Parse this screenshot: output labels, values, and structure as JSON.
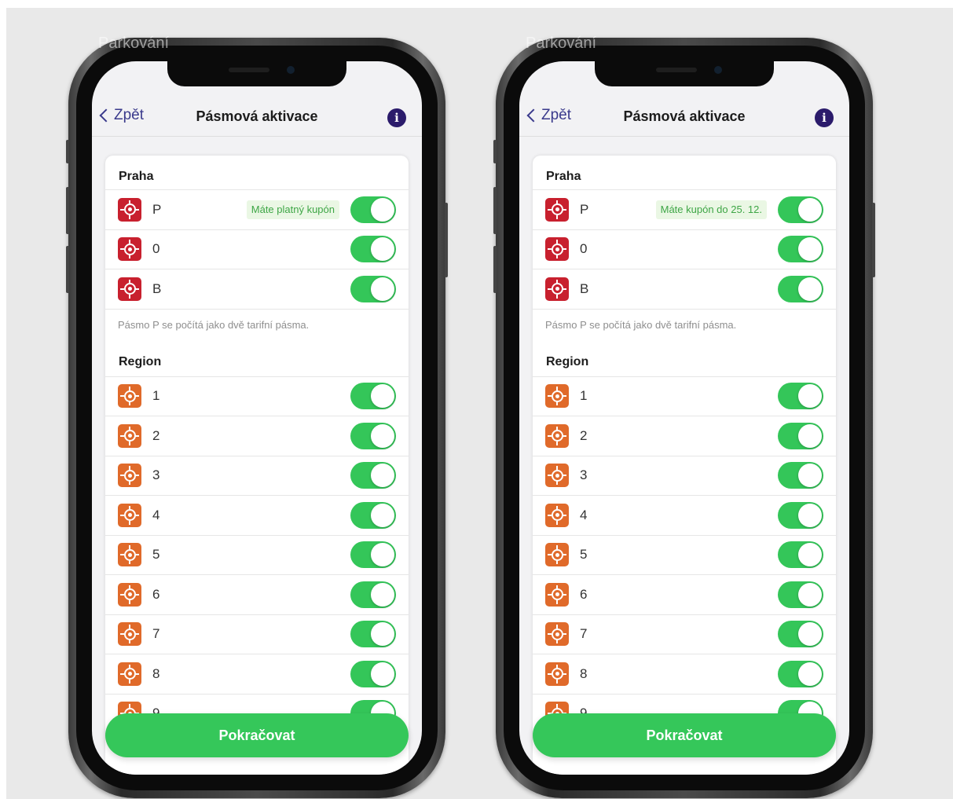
{
  "app_window_title": "Parkování",
  "screens": [
    {
      "nav": {
        "back_label": "Zpět",
        "title": "Pásmová aktivace",
        "info_glyph": "i"
      },
      "praha": {
        "title": "Praha",
        "zones": [
          {
            "label": "P",
            "icon": "target-icon",
            "color": "#c8202e",
            "on": true,
            "badge": "Máte platný kupón"
          },
          {
            "label": "0",
            "icon": "target-icon",
            "color": "#c8202e",
            "on": true
          },
          {
            "label": "B",
            "icon": "target-icon",
            "color": "#c8202e",
            "on": true
          }
        ],
        "note": "Pásmo P se počítá jako dvě tarifní pásma."
      },
      "region": {
        "title": "Region",
        "zones": [
          {
            "label": "1",
            "icon": "target-icon",
            "color": "#e06a2a",
            "on": true
          },
          {
            "label": "2",
            "icon": "target-icon",
            "color": "#e06a2a",
            "on": true
          },
          {
            "label": "3",
            "icon": "target-icon",
            "color": "#e06a2a",
            "on": true
          },
          {
            "label": "4",
            "icon": "target-icon",
            "color": "#e06a2a",
            "on": true
          },
          {
            "label": "5",
            "icon": "target-icon",
            "color": "#e06a2a",
            "on": true
          },
          {
            "label": "6",
            "icon": "target-icon",
            "color": "#e06a2a",
            "on": true
          },
          {
            "label": "7",
            "icon": "target-icon",
            "color": "#e06a2a",
            "on": true
          },
          {
            "label": "8",
            "icon": "target-icon",
            "color": "#e06a2a",
            "on": true
          },
          {
            "label": "9",
            "icon": "target-icon",
            "color": "#e06a2a",
            "on": true
          }
        ]
      },
      "continue_label": "Pokračovat"
    },
    {
      "nav": {
        "back_label": "Zpět",
        "title": "Pásmová aktivace",
        "info_glyph": "i"
      },
      "praha": {
        "title": "Praha",
        "zones": [
          {
            "label": "P",
            "icon": "target-icon",
            "color": "#c8202e",
            "on": true,
            "badge": "Máte kupón do 25. 12."
          },
          {
            "label": "0",
            "icon": "target-icon",
            "color": "#c8202e",
            "on": true
          },
          {
            "label": "B",
            "icon": "target-icon",
            "color": "#c8202e",
            "on": true
          }
        ],
        "note": "Pásmo P se počítá jako dvě tarifní pásma."
      },
      "region": {
        "title": "Region",
        "zones": [
          {
            "label": "1",
            "icon": "target-icon",
            "color": "#e06a2a",
            "on": true
          },
          {
            "label": "2",
            "icon": "target-icon",
            "color": "#e06a2a",
            "on": true
          },
          {
            "label": "3",
            "icon": "target-icon",
            "color": "#e06a2a",
            "on": true
          },
          {
            "label": "4",
            "icon": "target-icon",
            "color": "#e06a2a",
            "on": true
          },
          {
            "label": "5",
            "icon": "target-icon",
            "color": "#e06a2a",
            "on": true
          },
          {
            "label": "6",
            "icon": "target-icon",
            "color": "#e06a2a",
            "on": true
          },
          {
            "label": "7",
            "icon": "target-icon",
            "color": "#e06a2a",
            "on": true
          },
          {
            "label": "8",
            "icon": "target-icon",
            "color": "#e06a2a",
            "on": true
          },
          {
            "label": "9",
            "icon": "target-icon",
            "color": "#e06a2a",
            "on": true
          }
        ]
      },
      "continue_label": "Pokračovat"
    }
  ],
  "colors": {
    "toggle_on": "#34c659",
    "continue_button": "#35c75a",
    "badge_bg": "#eaf7e4",
    "badge_text": "#3ea646",
    "praha_icon": "#c8202e",
    "region_icon": "#e06a2a",
    "info_icon": "#2b1b6b",
    "back_link": "#3a3a8c"
  }
}
